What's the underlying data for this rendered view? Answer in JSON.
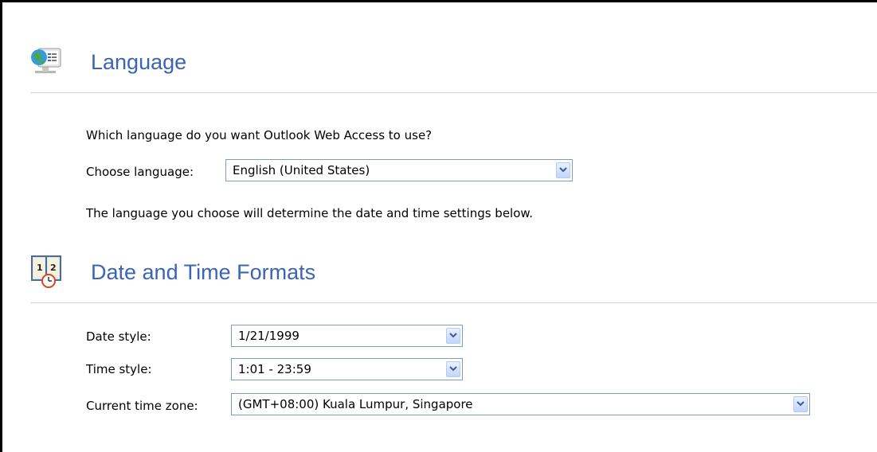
{
  "language_section": {
    "title": "Language",
    "icon": "globe-monitor-icon",
    "question": "Which language do you want Outlook Web Access to use?",
    "choose_label": "Choose language:",
    "choose_value": "English (United States)",
    "note": "The language you choose will determine the date and time settings below."
  },
  "datetime_section": {
    "title": "Date and Time Formats",
    "icon": "calendar-clock-icon",
    "date_style_label": "Date style:",
    "date_style_value": "1/21/1999",
    "time_style_label": "Time style:",
    "time_style_value": "1:01 - 23:59",
    "timezone_label": "Current time zone:",
    "timezone_value": "(GMT+08:00) Kuala Lumpur, Singapore"
  },
  "colors": {
    "heading": "#3b64b4",
    "rule": "#d4d0c8",
    "select_border": "#7f9db9"
  }
}
